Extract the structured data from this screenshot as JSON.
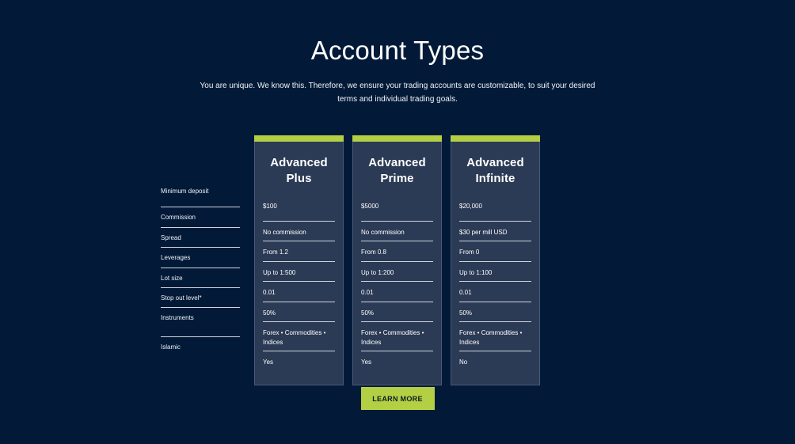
{
  "colors": {
    "page_background": "#021A38",
    "card_background": "#2B3A55",
    "accent_green": "#B3D045",
    "divider": "#CDD4DE",
    "text_primary": "#FFFFFF"
  },
  "header": {
    "title": "Account Types",
    "subtitle": "You are unique. We know this. Therefore, we ensure your trading accounts are customizable, to suit your desired terms and individual trading goals."
  },
  "comparison": {
    "row_labels": [
      "Minimum deposit",
      "Commission",
      "Spread",
      "Leverages",
      "Lot size",
      "Stop out level*",
      "Instruments",
      "Islamic"
    ],
    "cards": [
      {
        "title": "Advanced Plus",
        "title_lines": [
          "Advanced",
          "Plus"
        ],
        "values": [
          "$100",
          "No commission",
          "From 1.2",
          "Up to 1:500",
          "0.01",
          "50%",
          "Forex • Commodities • Indices",
          "Yes"
        ]
      },
      {
        "title": "Advanced Prime",
        "title_lines": [
          "Advanced",
          "Prime"
        ],
        "values": [
          "$5000",
          "No commission",
          "From 0.8",
          "Up to 1:200",
          "0.01",
          "50%",
          "Forex • Commodities • Indices",
          "Yes"
        ]
      },
      {
        "title": "Advanced Infinite",
        "title_lines": [
          "Advanced",
          "Infinite"
        ],
        "values": [
          "$20,000",
          "$30 per mill USD",
          "From 0",
          "Up to 1:100",
          "0.01",
          "50%",
          "Forex • Commodities • Indices",
          "No"
        ]
      }
    ]
  },
  "cta": {
    "label": "LEARN MORE"
  }
}
